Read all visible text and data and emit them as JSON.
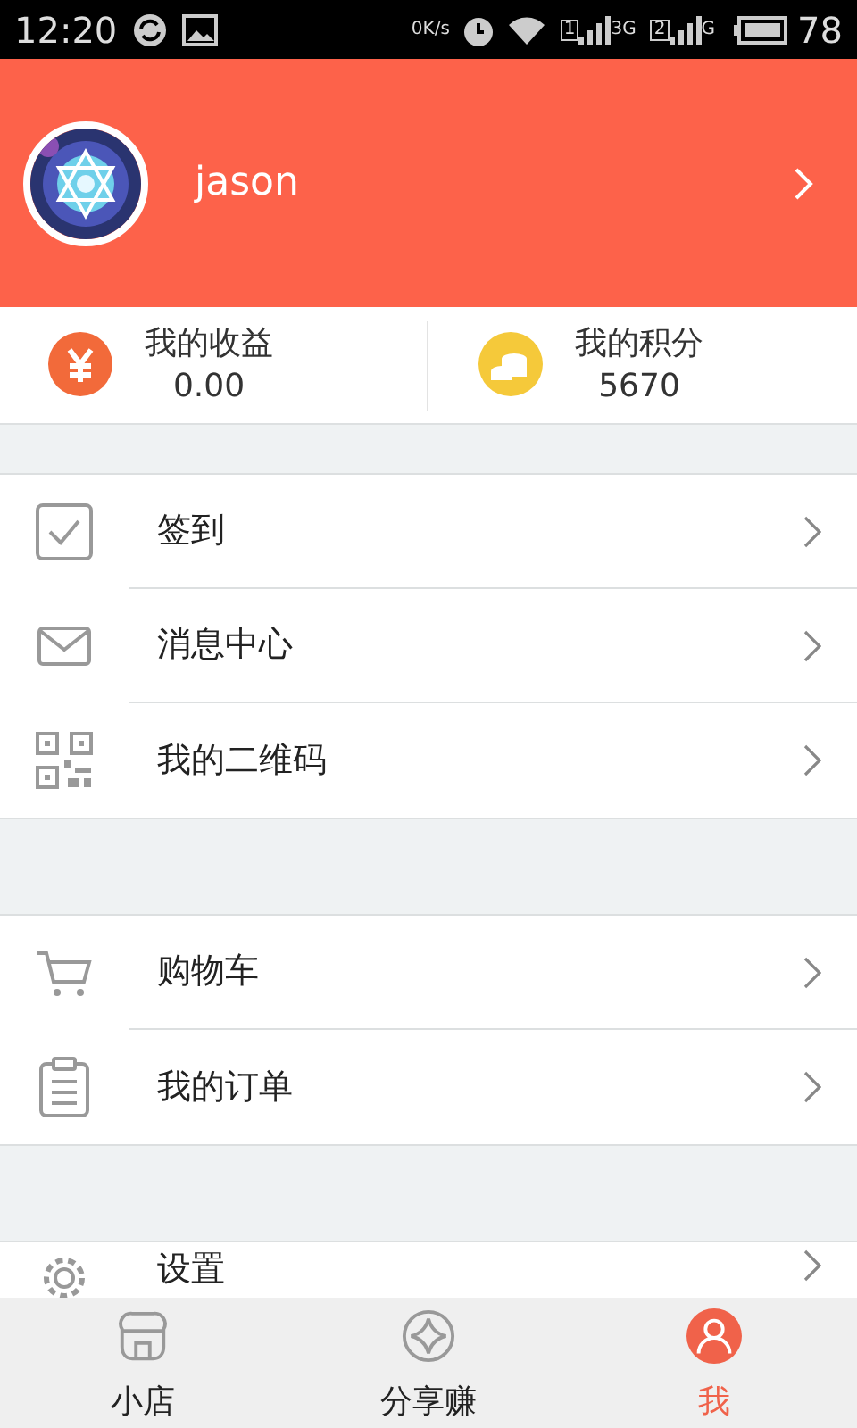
{
  "status_bar": {
    "time": "12:20",
    "net_speed": "0K/s",
    "sim1": "1",
    "sim1_network": "3G",
    "sim2": "2",
    "sim2_network": "G",
    "battery": "78"
  },
  "profile": {
    "username": "jason"
  },
  "stats": [
    {
      "kind": "income",
      "label": "我的收益",
      "value": "0.00"
    },
    {
      "kind": "points",
      "label": "我的积分",
      "value": "5670"
    }
  ],
  "menu_groups": [
    [
      {
        "kind": "checkin",
        "label": "签到"
      },
      {
        "kind": "message",
        "label": "消息中心"
      },
      {
        "kind": "qrcode",
        "label": "我的二维码"
      }
    ],
    [
      {
        "kind": "cart",
        "label": "购物车"
      },
      {
        "kind": "orders",
        "label": "我的订单"
      }
    ],
    [
      {
        "kind": "settings",
        "label": "设置"
      }
    ]
  ],
  "tabs": [
    {
      "kind": "shop",
      "label": "小店",
      "selected": false
    },
    {
      "kind": "share",
      "label": "分享赚",
      "selected": false
    },
    {
      "kind": "me",
      "label": "我",
      "selected": true
    }
  ]
}
